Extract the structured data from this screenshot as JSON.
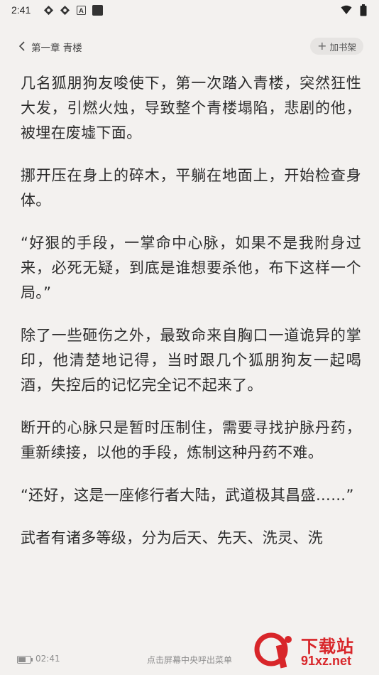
{
  "status_bar": {
    "time": "2:41",
    "icons": [
      "settings-badge-icon",
      "settings-badge-icon",
      "app-a-icon",
      "square-app-icon"
    ],
    "right_icons": [
      "wifi-icon",
      "battery-icon"
    ]
  },
  "header": {
    "back_label": "第一章 青楼",
    "add_shelf_label": "加书架"
  },
  "content": {
    "paragraphs": [
      "几名狐朋狗友唆使下，第一次踏入青楼，突然狂性大发，引燃火烛，导致整个青楼塌陷，悲剧的他，被埋在废墟下面。",
      "挪开压在身上的碎木，平躺在地面上，开始检查身体。",
      "“好狠的手段，一掌命中心脉，如果不是我附身过来，必死无疑，到底是谁想要杀他，布下这样一个局。”",
      "除了一些砸伤之外，最致命来自胸口一道诡异的掌印，他清楚地记得，当时跟几个狐朋狗友一起喝酒，失控后的记忆完全记不起来了。",
      "断开的心脉只是暂时压制住，需要寻找护脉丹药，重新续接，以他的手段，炼制这种丹药不难。",
      "“还好，这是一座修行者大陆，武道极其昌盛……”",
      "武者有诸多等级，分为后天、先天、洗灵、洗"
    ]
  },
  "footer": {
    "battery_level": 0.6,
    "time": "02:41",
    "hint": "点击屏幕中央呼出菜单"
  },
  "watermark": {
    "brand": "下载站",
    "url": "91xz.net",
    "color": "#d8262a"
  }
}
